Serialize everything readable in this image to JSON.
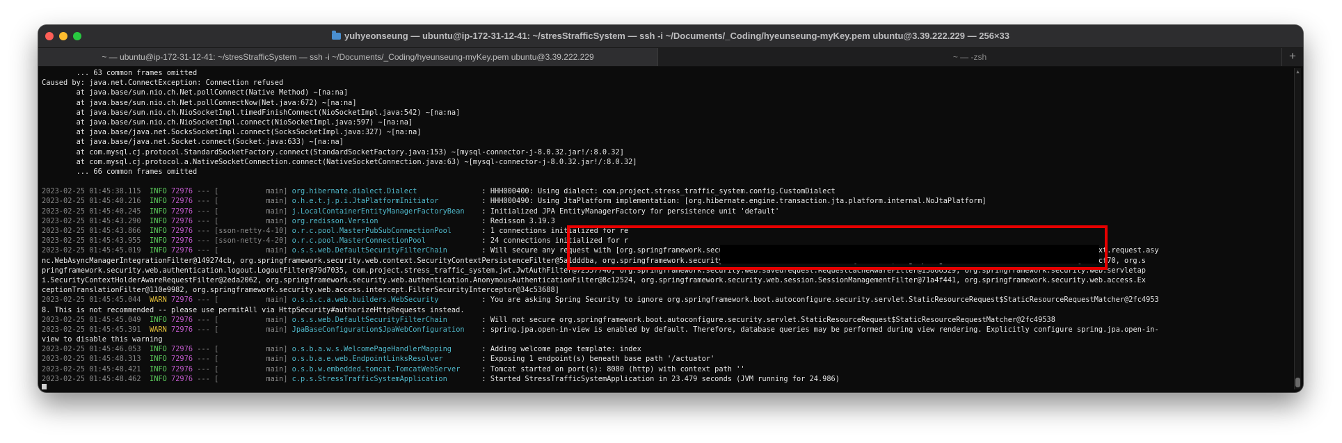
{
  "window": {
    "title": "yuhyeonseung — ubuntu@ip-172-31-12-41: ~/stresStrafficSystem — ssh -i ~/Documents/_Coding/hyeunseung-myKey.pem ubuntu@3.39.222.229 — 256×33",
    "tabs": [
      {
        "label": "~ — ubuntu@ip-172-31-12-41: ~/stresStrafficSystem — ssh -i ~/Documents/_Coding/hyeunseung-myKey.pem ubuntu@3.39.222.229"
      },
      {
        "label": "~ — -zsh"
      }
    ],
    "add_tab_label": "+"
  },
  "terminal": {
    "pre_lines": [
      "        ... 63 common frames omitted",
      "Caused by: java.net.ConnectException: Connection refused",
      "        at java.base/sun.nio.ch.Net.pollConnect(Native Method) ~[na:na]",
      "        at java.base/sun.nio.ch.Net.pollConnectNow(Net.java:672) ~[na:na]",
      "        at java.base/sun.nio.ch.NioSocketImpl.timedFinishConnect(NioSocketImpl.java:542) ~[na:na]",
      "        at java.base/sun.nio.ch.NioSocketImpl.connect(NioSocketImpl.java:597) ~[na:na]",
      "        at java.base/java.net.SocksSocketImpl.connect(SocksSocketImpl.java:327) ~[na:na]",
      "        at java.base/java.net.Socket.connect(Socket.java:633) ~[na:na]",
      "        at com.mysql.cj.protocol.StandardSocketFactory.connect(StandardSocketFactory.java:153) ~[mysql-connector-j-8.0.32.jar!/:8.0.32]",
      "        at com.mysql.cj.protocol.a.NativeSocketConnection.connect(NativeSocketConnection.java:63) ~[mysql-connector-j-8.0.32.jar!/:8.0.32]",
      "        ... 66 common frames omitted",
      ""
    ],
    "log_lines": [
      {
        "ts": "2023-02-25 01:45:38.115",
        "level": "INFO",
        "pid": "72976",
        "thread": "           main",
        "logger": "org.hibernate.dialect.Dialect              ",
        "msg": "HHH000400: Using dialect: com.project.stress_traffic_system.config.CustomDialect"
      },
      {
        "ts": "2023-02-25 01:45:40.216",
        "level": "INFO",
        "pid": "72976",
        "thread": "           main",
        "logger": "o.h.e.t.j.p.i.JtaPlatformInitiator         ",
        "msg": "HHH000490: Using JtaPlatform implementation: [org.hibernate.engine.transaction.jta.platform.internal.NoJtaPlatform]"
      },
      {
        "ts": "2023-02-25 01:45:40.245",
        "level": "INFO",
        "pid": "72976",
        "thread": "           main",
        "logger": "j.LocalContainerEntityManagerFactoryBean   ",
        "msg": "Initialized JPA EntityManagerFactory for persistence unit 'default'"
      },
      {
        "ts": "2023-02-25 01:45:43.290",
        "level": "INFO",
        "pid": "72976",
        "thread": "           main",
        "logger": "org.redisson.Version                       ",
        "msg": "Redisson 3.19.3"
      },
      {
        "ts": "2023-02-25 01:45:43.866",
        "level": "INFO",
        "pid": "72976",
        "thread": "sson-netty-4-10",
        "logger": "o.r.c.pool.MasterPubSubConnectionPool      ",
        "msg": "1 connections initialized for re"
      },
      {
        "ts": "2023-02-25 01:45:43.955",
        "level": "INFO",
        "pid": "72976",
        "thread": "sson-netty-4-20",
        "logger": "o.r.c.pool.MasterConnectionPool            ",
        "msg": "24 connections initialized for r"
      },
      {
        "ts": "2023-02-25 01:45:45.019",
        "level": "INFO",
        "pid": "72976",
        "thread": "           main",
        "logger": "o.s.s.web.DefaultSecurityFilterChain       ",
        "msg": "Will secure any request with [org.springframework.security.web.session.DisableEncodeUrlFilter@9fe720a, org.springframework.security.web.context.request.asy"
      }
    ],
    "mid_lines": [
      "nc.WebAsyncManagerIntegrationFilter@149274cb, org.springframework.security.web.context.SecurityContextPersistenceFilter@5a1dddba, org.springframework.security.web.header.HeaderWriterFilter@73608eb0, org.springframework.web.filter.CorsFilter@118acf70, org.s",
      "pringframework.security.web.authentication.logout.LogoutFilter@79d7035, com.project.stress_traffic_system.jwt.JwtAuthFilter@72557746, org.springframework.security.web.savedrequest.RequestCacheAwareFilter@13866329, org.springframework.security.web.servletap",
      "i.SecurityContextHolderAwareRequestFilter@2eda2062, org.springframework.security.web.authentication.AnonymousAuthenticationFilter@8c12524, org.springframework.security.web.session.SessionManagementFilter@71a4f441, org.springframework.security.web.access.Ex",
      "ceptionTranslationFilter@110e9982, org.springframework.security.web.access.intercept.FilterSecurityInterceptor@34c53688]"
    ],
    "log_lines_2": [
      {
        "ts": "2023-02-25 01:45:45.044",
        "level": "WARN",
        "pid": "72976",
        "thread": "           main",
        "logger": "o.s.s.c.a.web.builders.WebSecurity         ",
        "msg": "You are asking Spring Security to ignore org.springframework.boot.autoconfigure.security.servlet.StaticResourceRequest$StaticResourceRequestMatcher@2fc4953"
      }
    ],
    "cont_line_1": "8. This is not recommended -- please use permitAll via HttpSecurity#authorizeHttpRequests instead.",
    "log_lines_3": [
      {
        "ts": "2023-02-25 01:45:45.049",
        "level": "INFO",
        "pid": "72976",
        "thread": "           main",
        "logger": "o.s.s.web.DefaultSecurityFilterChain       ",
        "msg": "Will not secure org.springframework.boot.autoconfigure.security.servlet.StaticResourceRequest$StaticResourceRequestMatcher@2fc49538"
      },
      {
        "ts": "2023-02-25 01:45:45.391",
        "level": "WARN",
        "pid": "72976",
        "thread": "           main",
        "logger": "JpaBaseConfiguration$JpaWebConfiguration   ",
        "msg": "spring.jpa.open-in-view is enabled by default. Therefore, database queries may be performed during view rendering. Explicitly configure spring.jpa.open-in-"
      }
    ],
    "cont_line_2": "view to disable this warning",
    "log_lines_4": [
      {
        "ts": "2023-02-25 01:45:46.053",
        "level": "INFO",
        "pid": "72976",
        "thread": "           main",
        "logger": "o.s.b.a.w.s.WelcomePageHandlerMapping      ",
        "msg": "Adding welcome page template: index"
      },
      {
        "ts": "2023-02-25 01:45:48.313",
        "level": "INFO",
        "pid": "72976",
        "thread": "           main",
        "logger": "o.s.b.a.e.web.EndpointLinksResolver        ",
        "msg": "Exposing 1 endpoint(s) beneath base path '/actuator'"
      },
      {
        "ts": "2023-02-25 01:45:48.421",
        "level": "INFO",
        "pid": "72976",
        "thread": "           main",
        "logger": "o.s.b.w.embedded.tomcat.TomcatWebServer    ",
        "msg": "Tomcat started on port(s): 8080 (http) with context path ''"
      },
      {
        "ts": "2023-02-25 01:45:48.462",
        "level": "INFO",
        "pid": "72976",
        "thread": "           main",
        "logger": "c.p.s.StressTrafficSystemApplication       ",
        "msg": "Started StressTrafficSystemApplication in 23.479 seconds (JVM running for 24.986)"
      }
    ]
  },
  "colors": {
    "terminal_bg": "#0c0c0c",
    "info": "#5fd35f",
    "warn": "#e6c13a",
    "pid": "#c45ccf",
    "logger": "#4fb6c8",
    "highlight_border": "#e60000"
  }
}
